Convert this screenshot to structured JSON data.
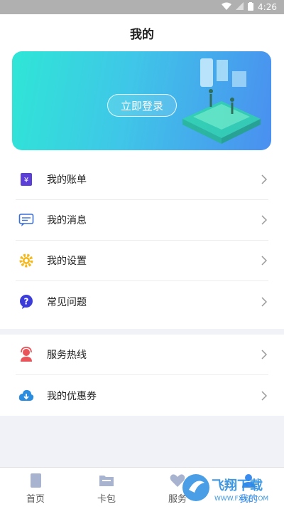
{
  "status_bar": {
    "time": "4:26"
  },
  "header": {
    "title": "我的"
  },
  "banner": {
    "login_label": "立即登录"
  },
  "menu_group_1": [
    {
      "label": "我的账单",
      "icon": "bill-icon",
      "color": "#5b3fd6"
    },
    {
      "label": "我的消息",
      "icon": "message-icon",
      "color": "#3a6fd8"
    },
    {
      "label": "我的设置",
      "icon": "gear-icon",
      "color": "#f5b81c"
    },
    {
      "label": "常见问题",
      "icon": "question-icon",
      "color": "#3c3cd8"
    }
  ],
  "menu_group_2": [
    {
      "label": "服务热线",
      "icon": "hotline-icon",
      "color": "#e8545a"
    },
    {
      "label": "我的优惠券",
      "icon": "coupon-download-icon",
      "color": "#2a8de0"
    }
  ],
  "tabs": [
    {
      "label": "首页",
      "icon": "home-icon"
    },
    {
      "label": "卡包",
      "icon": "wallet-icon"
    },
    {
      "label": "服务",
      "icon": "heart-icon"
    },
    {
      "label": "我的",
      "icon": "user-icon",
      "active": true
    }
  ],
  "watermark": {
    "text": "飞翔下载",
    "url": "WWW.FXXZ.COM"
  },
  "colors": {
    "accent": "#3a8bf0",
    "banner_start": "#2fe6d6",
    "banner_end": "#4a8ff0"
  }
}
